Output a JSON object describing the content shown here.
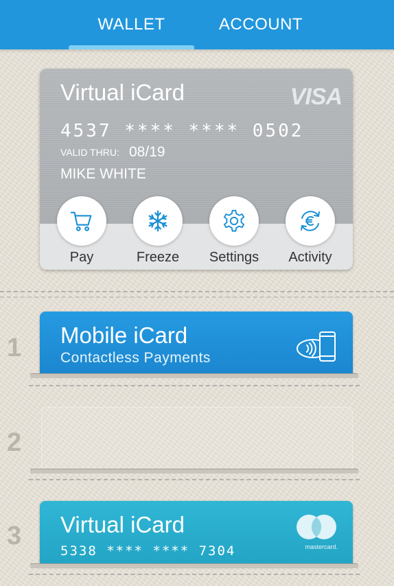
{
  "tabs": [
    {
      "label": "WALLET",
      "active": true
    },
    {
      "label": "ACCOUNT",
      "active": false
    }
  ],
  "main_card": {
    "title": "Virtual iCard",
    "network": "VISA",
    "number": "4537 **** **** 0502",
    "valid_label": "VALID THRU:",
    "valid_value": "08/19",
    "holder": "MIKE WHITE",
    "actions": [
      {
        "label": "Pay",
        "icon": "cart-icon"
      },
      {
        "label": "Freeze",
        "icon": "snowflake-icon"
      },
      {
        "label": "Settings",
        "icon": "gear-icon"
      },
      {
        "label": "Activity",
        "icon": "euro-cycle-icon"
      }
    ]
  },
  "slots": [
    {
      "number": "1",
      "title": "Mobile iCard",
      "subtitle": "Contactless Payments",
      "icon": "contactless-phone-icon"
    },
    {
      "number": "2"
    },
    {
      "number": "3",
      "title": "Virtual iCard",
      "card_number": "5338 **** **** 7304",
      "network": "mastercard."
    }
  ],
  "colors": {
    "header": "#2196dd",
    "tab_indicator": "#7fd0f5",
    "mobile_card": "#1e90d8",
    "teal_card": "#2aadcd",
    "main_card": "#adb1b5",
    "icon_accent": "#1a8fd6"
  }
}
